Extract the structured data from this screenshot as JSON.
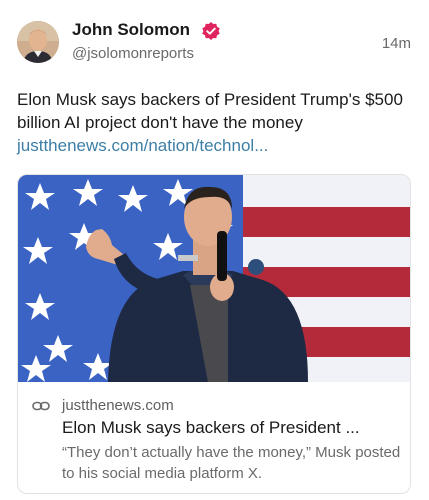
{
  "author": {
    "name": "John Solomon",
    "handle": "@jsolomonreports",
    "verified_color": "#e0245e"
  },
  "post": {
    "timestamp": "14m",
    "text": "Elon Musk says backers of President Trump's $500 billion AI project don't have the money",
    "link_text": "justthenews.com/nation/technol..."
  },
  "card": {
    "domain": "justthenews.com",
    "title": "Elon Musk says backers of President ...",
    "description": "“They don’t actually have the money,” Musk posted to his social media platform X."
  },
  "colors": {
    "link": "#3d7ea6",
    "flag_blue": "#3a63c4",
    "flag_red": "#b52a3a"
  },
  "icons": {
    "verified": "verified-badge-icon",
    "link": "link-chain-icon"
  }
}
